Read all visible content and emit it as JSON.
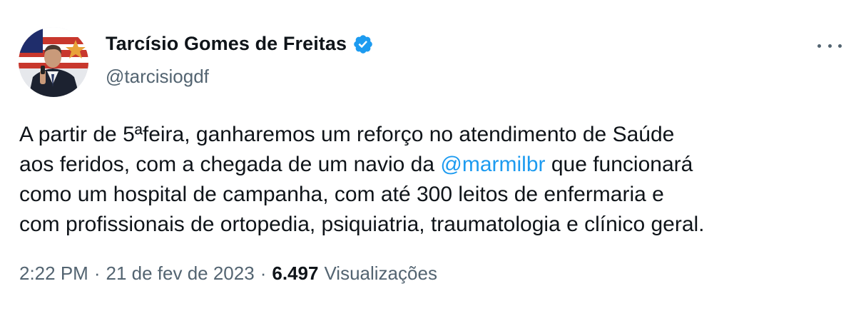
{
  "author": {
    "name": "Tarcísio Gomes de Freitas",
    "handle": "@tarcisiogdf",
    "verified_color": "#1d9bf0"
  },
  "tweet": {
    "lines": [
      "A partir de 5ªfeira, ganharemos um reforço no atendimento de Saúde",
      {
        "before": "aos feridos, com a chegada de um navio da ",
        "mention": "@marmilbr",
        "after": " que funcionará"
      },
      "como um hospital de campanha, com até 300 leitos de enfermaria e",
      "com profissionais de ortopedia, psiquiatria, traumatologia e clínico geral."
    ]
  },
  "meta": {
    "time": "2:22 PM",
    "separator": "·",
    "date": "21 de fev de 2023",
    "views_count": "6.497",
    "views_label": "Visualizações"
  },
  "colors": {
    "text": "#0f1419",
    "secondary": "#536471",
    "link": "#1d9bf0"
  },
  "icons": {
    "verified": "verified-badge-icon",
    "more": "more-options-icon"
  }
}
